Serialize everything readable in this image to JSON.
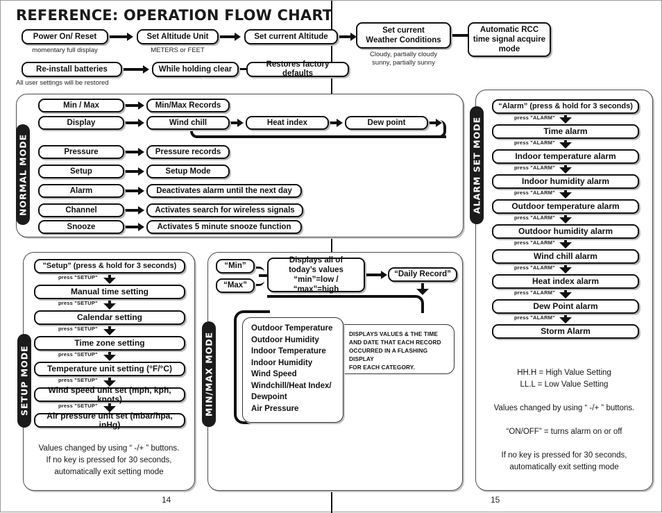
{
  "title": "REFERENCE: OPERATION FLOW CHART",
  "pages": {
    "left": "14",
    "right": "15"
  },
  "startup": {
    "row1": [
      {
        "label": "Power On/ Reset",
        "caption": "momentary full display"
      },
      {
        "label": "Set Altitude Unit",
        "caption": "METERS or FEET"
      },
      {
        "label": "Set current Altitude",
        "caption": ""
      },
      {
        "label": "Set current\nWeather Conditions",
        "caption": "Cloudy, partially cloudy\nsunny, partially sunny"
      },
      {
        "label": "Automatic RCC\ntime signal acquire\nmode",
        "caption": ""
      }
    ],
    "row2": [
      {
        "label": "Re-install batteries",
        "caption": "All user settings will be restored"
      },
      {
        "label": "While holding clear",
        "caption": ""
      },
      {
        "label": "Restores factory defaults",
        "caption": ""
      }
    ]
  },
  "normal_mode": {
    "tab": "NORMAL MODE",
    "rows": [
      {
        "key": "Min / Max",
        "targets": [
          "Min/Max Records"
        ]
      },
      {
        "key": "Display",
        "targets": [
          "Wind chill",
          "Heat index",
          "Dew point"
        ]
      },
      {
        "key": "Pressure",
        "targets": [
          "Pressure records"
        ]
      },
      {
        "key": "Setup",
        "targets": [
          "Setup Mode"
        ]
      },
      {
        "key": "Alarm",
        "targets": [
          "Deactivates alarm until the next day"
        ]
      },
      {
        "key": "Channel",
        "targets": [
          "Activates search for wireless signals"
        ]
      },
      {
        "key": "Snooze",
        "targets": [
          "Activates 5 minute snooze function"
        ]
      }
    ]
  },
  "setup_mode": {
    "tab": "SETUP MODE",
    "step_label": "press \"SETUP\"",
    "steps": [
      "\"Setup\" (press & hold for 3 seconds)",
      "Manual time setting",
      "Calendar setting",
      "Time zone setting",
      "Temperature unit setting (°F/°C)",
      "Wind speed unit set (mph, kph, knots)",
      "Air pressure unit set (mbar/hpa, inHg)"
    ],
    "notes": "Values changed by using “ -/+ ” buttons.\nIf no key is pressed for 30 seconds,\nautomatically exit setting mode"
  },
  "minmax_mode": {
    "tab": "MIN/MAX MODE",
    "min_button": "“Min”",
    "max_button": "“Max”",
    "displays_box": "Displays all of\ntoday’s values\n“min”=low / “max”=high",
    "daily_record": "“Daily Record”",
    "categories": [
      "Outdoor Temperature",
      "Outdoor Humidity",
      "Indoor Temperature",
      "Indoor Humidity",
      "Wind Speed",
      "Windchill/Heat Index/\nDewpoint",
      "Air Pressure"
    ],
    "info": "DISPLAYS VALUES & THE TIME\nAND DATE THAT EACH RECORD\nOCCURRED IN A FLASHING DISPLAY\nFOR EACH CATEGORY."
  },
  "alarm_mode": {
    "tab": "ALARM SET MODE",
    "step_label": "press \"ALARM\"",
    "steps": [
      "“Alarm” (press & hold for 3 seconds)",
      "Time alarm",
      "Indoor temperature alarm",
      "Indoor humidity alarm",
      "Outdoor temperature alarm",
      "Outdoor humidity alarm",
      "Wind chill alarm",
      "Heat index alarm",
      "Dew Point alarm",
      "Storm Alarm"
    ],
    "notes": "HH.H = High Value Setting\nLL.L = Low Value Setting\n\nValues changed by using “ -/+ ” buttons.\n\n“ON/OFF” = turns alarm on or off\n\nIf no key is pressed for 30 seconds,\nautomatically exit setting mode"
  },
  "colors": {
    "ink": "#111111",
    "tab_bg": "#1b1b1b",
    "shadow": "#bdbdbd"
  }
}
